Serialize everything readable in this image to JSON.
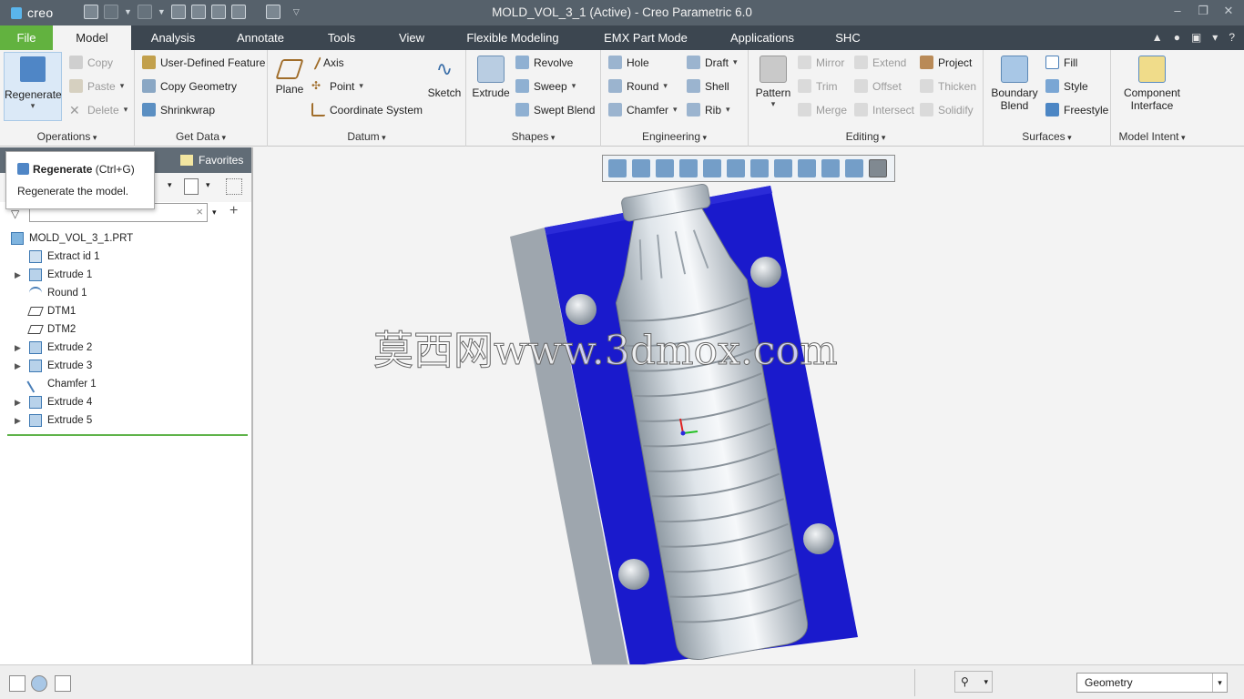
{
  "app": {
    "logo": "creo",
    "window_title": "MOLD_VOL_3_1 (Active) - Creo Parametric 6.0"
  },
  "tabs": [
    "File",
    "Model",
    "Analysis",
    "Annotate",
    "Tools",
    "View",
    "Flexible Modeling",
    "EMX Part Mode",
    "Applications",
    "SHC"
  ],
  "groups": {
    "operations": {
      "label": "Operations",
      "regenerate": "Regenerate",
      "copy": "Copy",
      "paste": "Paste",
      "delete": "Delete"
    },
    "getdata": {
      "label": "Get Data",
      "udf": "User-Defined Feature",
      "copygeom": "Copy Geometry",
      "shrinkwrap": "Shrinkwrap"
    },
    "datum": {
      "label": "Datum",
      "plane": "Plane",
      "axis": "Axis",
      "point": "Point",
      "csys": "Coordinate System",
      "sketch": "Sketch"
    },
    "shapes": {
      "label": "Shapes",
      "extrude": "Extrude",
      "revolve": "Revolve",
      "sweep": "Sweep",
      "sweptblend": "Swept Blend"
    },
    "engineering": {
      "label": "Engineering",
      "hole": "Hole",
      "round": "Round",
      "chamfer": "Chamfer",
      "draft": "Draft",
      "shell": "Shell",
      "rib": "Rib"
    },
    "editing": {
      "label": "Editing",
      "pattern": "Pattern",
      "mirror": "Mirror",
      "trim": "Trim",
      "merge": "Merge",
      "extend": "Extend",
      "offset": "Offset",
      "intersect": "Intersect",
      "project": "Project",
      "thicken": "Thicken",
      "solidify": "Solidify"
    },
    "surfaces": {
      "label": "Surfaces",
      "boundary1": "Boundary",
      "boundary2": "Blend",
      "fill": "Fill",
      "style": "Style",
      "freestyle": "Freestyle"
    },
    "modelintent": {
      "label": "Model Intent",
      "ci1": "Component",
      "ci2": "Interface"
    }
  },
  "tooltip": {
    "title": "Regenerate",
    "shortcut": "(Ctrl+G)",
    "description": "Regenerate the model."
  },
  "panel": {
    "favorites": "Favorites"
  },
  "tree": [
    {
      "label": "MOLD_VOL_3_1.PRT",
      "expand": ""
    },
    {
      "label": "Extract id 1",
      "expand": ""
    },
    {
      "label": "Extrude 1",
      "expand": "▶"
    },
    {
      "label": "Round 1",
      "expand": ""
    },
    {
      "label": "DTM1",
      "expand": ""
    },
    {
      "label": "DTM2",
      "expand": ""
    },
    {
      "label": "Extrude 2",
      "expand": "▶"
    },
    {
      "label": "Extrude 3",
      "expand": "▶"
    },
    {
      "label": "Chamfer 1",
      "expand": ""
    },
    {
      "label": "Extrude 4",
      "expand": "▶"
    },
    {
      "label": "Extrude 5",
      "expand": "▶"
    }
  ],
  "viewport": {
    "watermark": "莫西网www.3dmox.com",
    "mold_color": "#1a1acc"
  },
  "status": {
    "filter_value": "Geometry"
  }
}
